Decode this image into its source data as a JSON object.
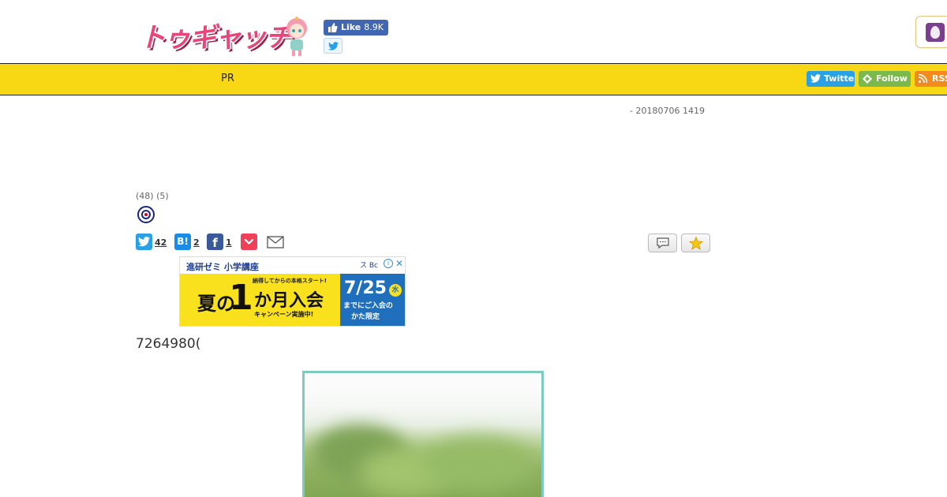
{
  "header": {
    "logo_text": "トゥギャッチ",
    "fb_like": {
      "label": "Like",
      "count": "8.9K"
    }
  },
  "nav": {
    "pr_label": "PR",
    "social": {
      "twitter": "Twitter",
      "follow": "Follow",
      "rss": "RSS"
    }
  },
  "post": {
    "date_line": "- 20180706 1419",
    "counts": "(48) (5)",
    "share": {
      "twitter_count": "42",
      "hatena_label": "B!",
      "hatena_count": "2",
      "facebook_label": "f",
      "facebook_count": "1"
    },
    "text": "7264980("
  },
  "ad": {
    "title": "進研ゼミ 小学講座",
    "choices": "ス Bc",
    "info": "i",
    "close": "✕",
    "small": "納得してからの本格スタート!",
    "natsu": "夏の",
    "one": "1",
    "nyukai": "か月入会",
    "campaign": "キャンペーン実施中!",
    "date": "7/25",
    "weekday": "水",
    "until1": "までにご入会の",
    "until2": "かた限定"
  },
  "colors": {
    "navbar": "#f8d714",
    "twitter": "#29a1e4",
    "follow": "#7cb94d",
    "rss": "#f28a1e",
    "photo_border": "#7ccbc1"
  },
  "icons": [
    "facebook-thumb-icon",
    "twitter-bird-icon",
    "follow-icon",
    "rss-icon",
    "roundel-icon",
    "pocket-icon",
    "mail-icon",
    "comment-icon",
    "star-icon"
  ]
}
